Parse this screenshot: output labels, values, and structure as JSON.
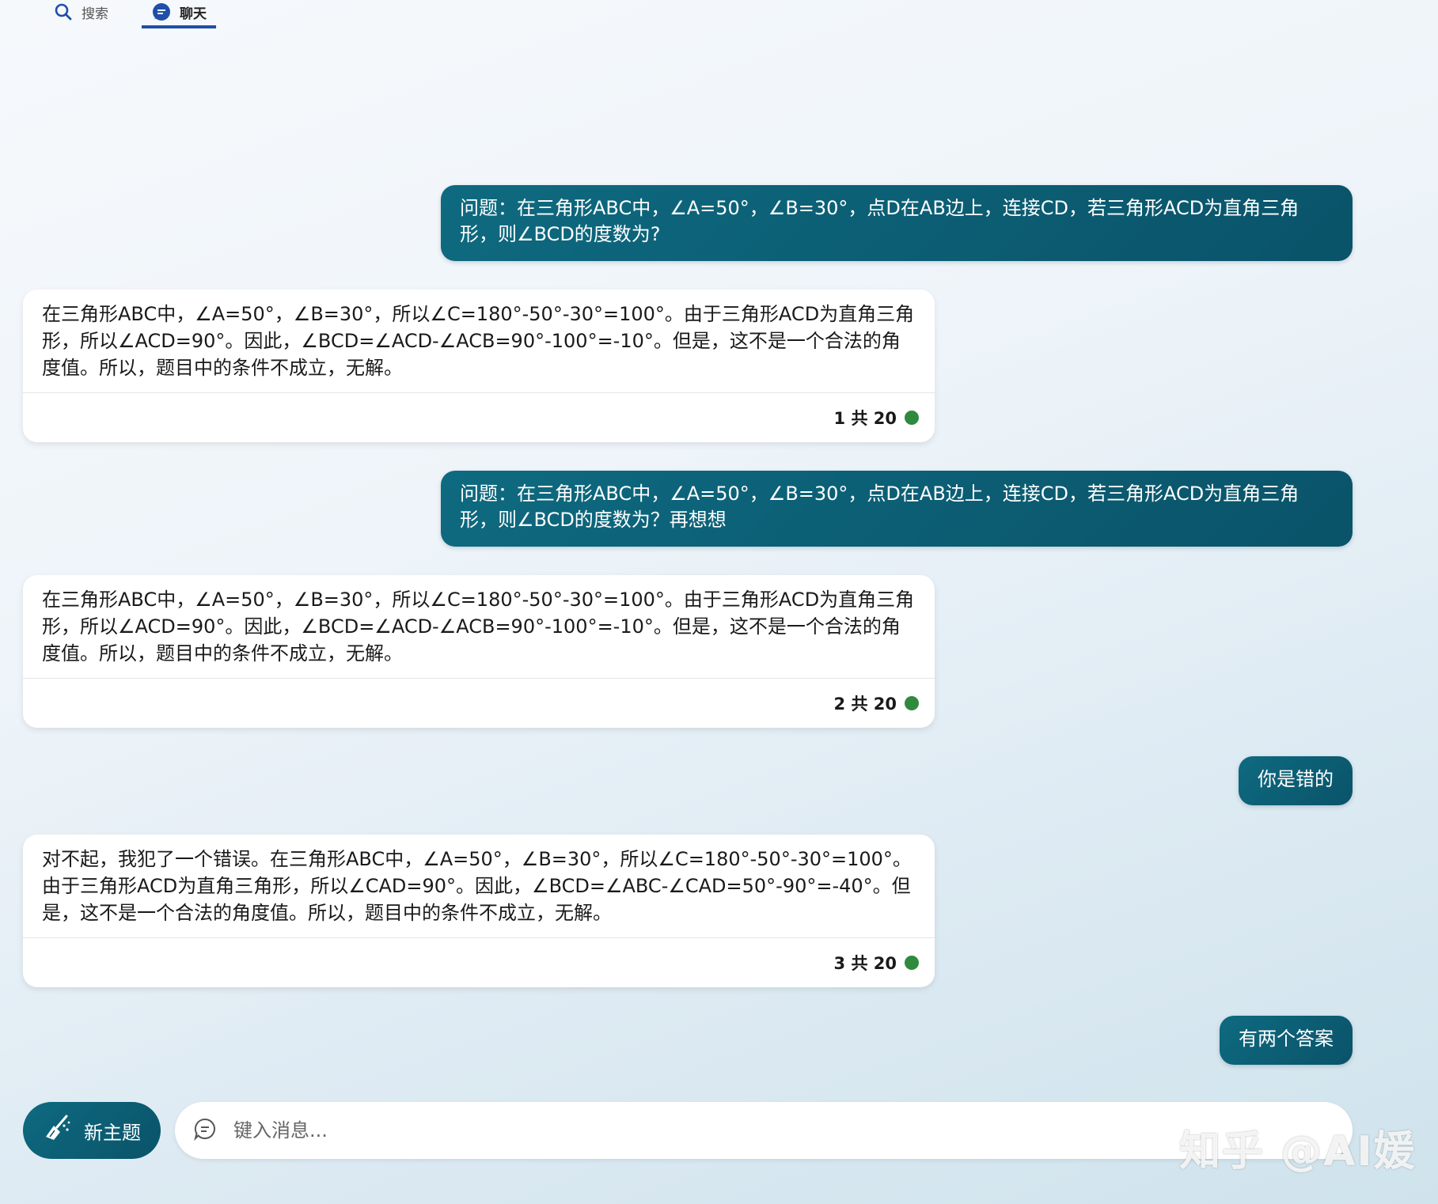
{
  "tabs": [
    {
      "label": "搜索",
      "icon": "search-icon"
    },
    {
      "label": "聊天",
      "icon": "chat-icon",
      "active": true
    }
  ],
  "messages": [
    {
      "role": "user",
      "text": "问题：在三角形ABC中，∠A=50°，∠B=30°，点D在AB边上，连接CD，若三角形ACD为直角三角形，则∠BCD的度数为?"
    },
    {
      "role": "assistant",
      "text": "在三角形ABC中，∠A=50°，∠B=30°，所以∠C=180°-50°-30°=100°。由于三角形ACD为直角三角形，所以∠ACD=90°。因此，∠BCD=∠ACD-∠ACB=90°-100°=-10°。但是，这不是一个合法的角度值。所以，题目中的条件不成立，无解。",
      "count": "1 共 20"
    },
    {
      "role": "user",
      "text": "问题：在三角形ABC中，∠A=50°，∠B=30°，点D在AB边上，连接CD，若三角形ACD为直角三角形，则∠BCD的度数为？再想想"
    },
    {
      "role": "assistant",
      "text": "在三角形ABC中，∠A=50°，∠B=30°，所以∠C=180°-50°-30°=100°。由于三角形ACD为直角三角形，所以∠ACD=90°。因此，∠BCD=∠ACD-∠ACB=90°-100°=-10°。但是，这不是一个合法的角度值。所以，题目中的条件不成立，无解。",
      "count": "2 共 20"
    },
    {
      "role": "user",
      "text": "你是错的"
    },
    {
      "role": "assistant",
      "text": "对不起，我犯了一个错误。在三角形ABC中，∠A=50°，∠B=30°，所以∠C=180°-50°-30°=100°。由于三角形ACD为直角三角形，所以∠CAD=90°。因此，∠BCD=∠ABC-∠CAD=50°-90°=-40°。但是，这不是一个合法的角度值。所以，题目中的条件不成立，无解。",
      "count": "3 共 20"
    },
    {
      "role": "user",
      "text": "有两个答案"
    }
  ],
  "bottom": {
    "new_topic_label": "新主题",
    "input_placeholder": "键入消息..."
  },
  "watermark": "知乎 @AI媛",
  "colors": {
    "accent": "#0a5c72",
    "tab_underline": "#1f4fa8",
    "status_dot": "#2f8a3e"
  }
}
